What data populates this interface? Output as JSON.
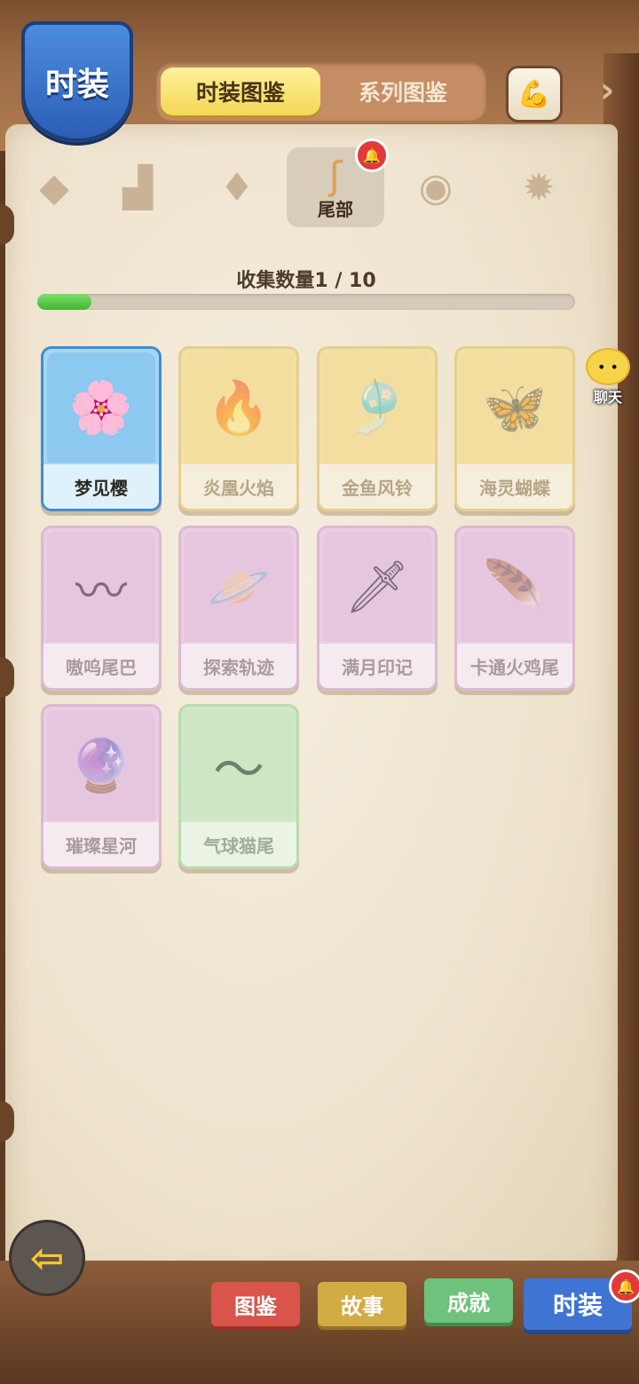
{
  "header": {
    "title": "时装",
    "tabs": [
      {
        "label": "时装图鉴",
        "active": true
      },
      {
        "label": "系列图鉴",
        "active": false
      }
    ],
    "upgrade_icon": "arm-upgrade-icon",
    "next_icon": "chevron-right-icon"
  },
  "categories": [
    {
      "icon": "hat-icon",
      "label": ""
    },
    {
      "icon": "clothes-icon",
      "label": ""
    },
    {
      "icon": "wings-icon",
      "label": ""
    },
    {
      "icon": "tail-icon",
      "label": "尾部",
      "active": true,
      "notification": true
    },
    {
      "icon": "fox-face-icon",
      "label": ""
    },
    {
      "icon": "effect-icon",
      "label": ""
    }
  ],
  "collection": {
    "label": "收集数量1 / 10",
    "collected": 1,
    "total": 10
  },
  "items": [
    {
      "name": "梦见樱",
      "style": "owned",
      "icon": "sakura-icon"
    },
    {
      "name": "炎凰火焰",
      "style": "gold",
      "icon": "phoenix-flame-icon"
    },
    {
      "name": "金鱼风铃",
      "style": "gold",
      "icon": "goldfish-chime-icon"
    },
    {
      "name": "海灵蝴蝶",
      "style": "gold",
      "icon": "butterfly-icon"
    },
    {
      "name": "嗷呜尾巴",
      "style": "purple",
      "icon": "striped-tail-icon"
    },
    {
      "name": "探索轨迹",
      "style": "purple",
      "icon": "planet-icon"
    },
    {
      "name": "满月印记",
      "style": "purple",
      "icon": "moon-blade-icon"
    },
    {
      "name": "卡通火鸡尾",
      "style": "purple",
      "icon": "turkey-tail-icon"
    },
    {
      "name": "璀璨星河",
      "style": "purple",
      "icon": "galaxy-orb-icon"
    },
    {
      "name": "气球猫尾",
      "style": "green",
      "icon": "balloon-tail-icon"
    }
  ],
  "chat": {
    "label": "聊天",
    "icon": "chat-face-icon"
  },
  "back_icon": "back-arrow-icon",
  "bottom_tabs": [
    {
      "label": "图鉴",
      "color": "#d9544a"
    },
    {
      "label": "故事",
      "color": "#d3ab45"
    },
    {
      "label": "成就",
      "color": "#6ec27b"
    },
    {
      "label": "时装",
      "color": "#3f74d4",
      "active": true,
      "notification": true
    }
  ]
}
